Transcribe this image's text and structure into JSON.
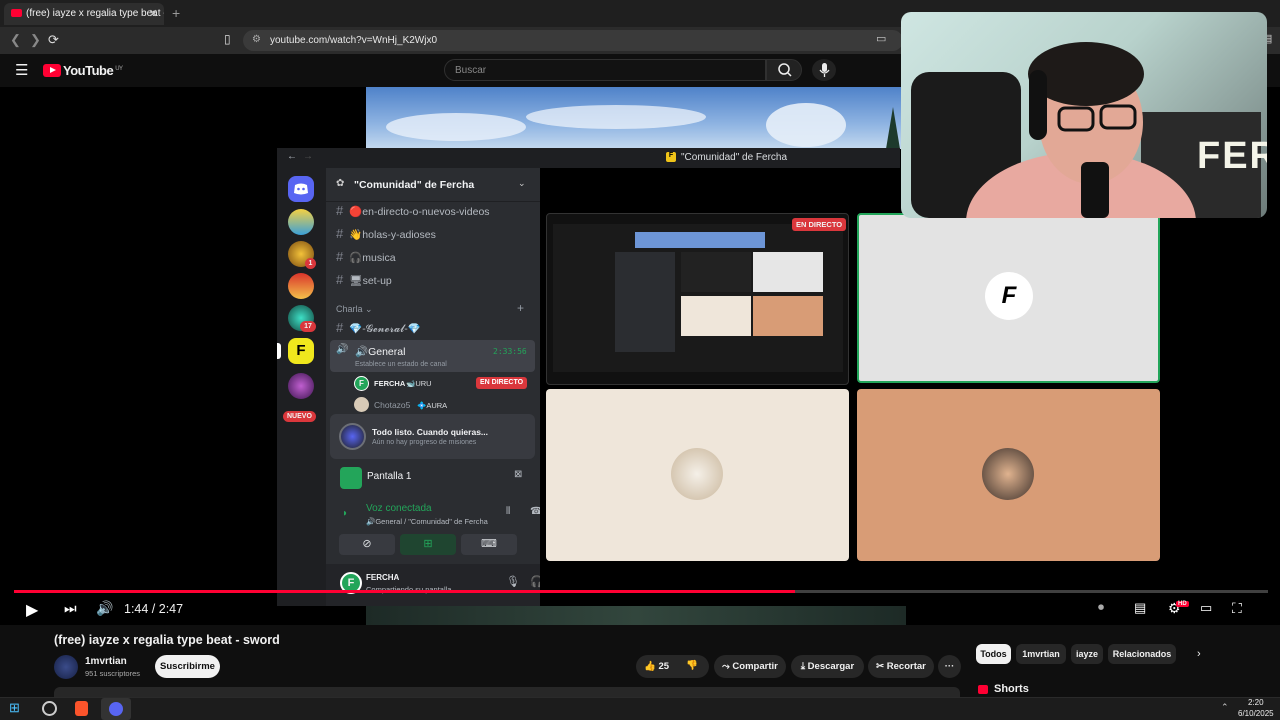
{
  "browser": {
    "tab_title": "(free) iayze x regalia type beat -",
    "url": "youtube.com/watch?v=WnHj_K2Wjx0"
  },
  "youtube": {
    "logo_text": "YouTube",
    "region": "UY",
    "search_placeholder": "Buscar"
  },
  "discord": {
    "window_title": "\"Comunidad\" de Fercha",
    "server_name": "\"Comunidad\" de Fercha",
    "channels": [
      {
        "name": "🔴en-directo-o-nuevos-videos"
      },
      {
        "name": "👋holas-y-adioses"
      },
      {
        "name": "🎧musica"
      },
      {
        "name": "🖥set-up"
      }
    ],
    "category": "Charla",
    "text_channel_charla": "💎-𝓖𝓮𝓷𝓮𝓻𝓪𝓵-💎",
    "voice_channel": "🔊General",
    "voice_timer": "2:33:56",
    "voice_status_hint": "Establece un estado de canal",
    "voice_users": [
      {
        "name": "FERCHA",
        "tag": "🐋URU",
        "badge": "EN DIRECTO"
      },
      {
        "name": "Chotazo5",
        "tag": "💠AURA"
      }
    ],
    "guild_badges": [
      "1",
      "17"
    ],
    "nuevo_badge": "NUEVO",
    "mission_title": "Todo listo. Cuando quieras...",
    "mission_sub": "Aún no hay progreso de misiones",
    "screen_share": "Pantalla 1",
    "voice_connected": "Voz conectada",
    "voice_location": "🔊General / \"Comunidad\" de Fercha",
    "user_name": "FERCHA",
    "user_status": "Compartiendo su pantalla",
    "live_label": "EN DIRECTO",
    "tile_letter": "F"
  },
  "player": {
    "time": "1:44 / 2:47",
    "progress": 0.623,
    "hd_badge": "HD"
  },
  "video": {
    "title": "(free) iayze x regalia type beat - sword",
    "channel": "1mvrtian",
    "subscribers": "951 suscriptores",
    "subscribe_label": "Suscribirme",
    "likes": "25",
    "share_label": "Compartir",
    "download_label": "Descargar",
    "clip_label": "Recortar",
    "more_label": "···"
  },
  "sidebar": {
    "chips": [
      "Todos",
      "1mvrtian",
      "iayze",
      "Relacionados"
    ],
    "shorts_label": "Shorts"
  },
  "taskbar": {
    "time": "2:20",
    "date": "6/10/2025"
  },
  "webcam": {
    "sign_text": "FER"
  },
  "colors": {
    "yt_red": "#ff0033",
    "discord_green": "#23a55a",
    "live_red": "#da373c",
    "discord_blurple": "#5865f2"
  }
}
